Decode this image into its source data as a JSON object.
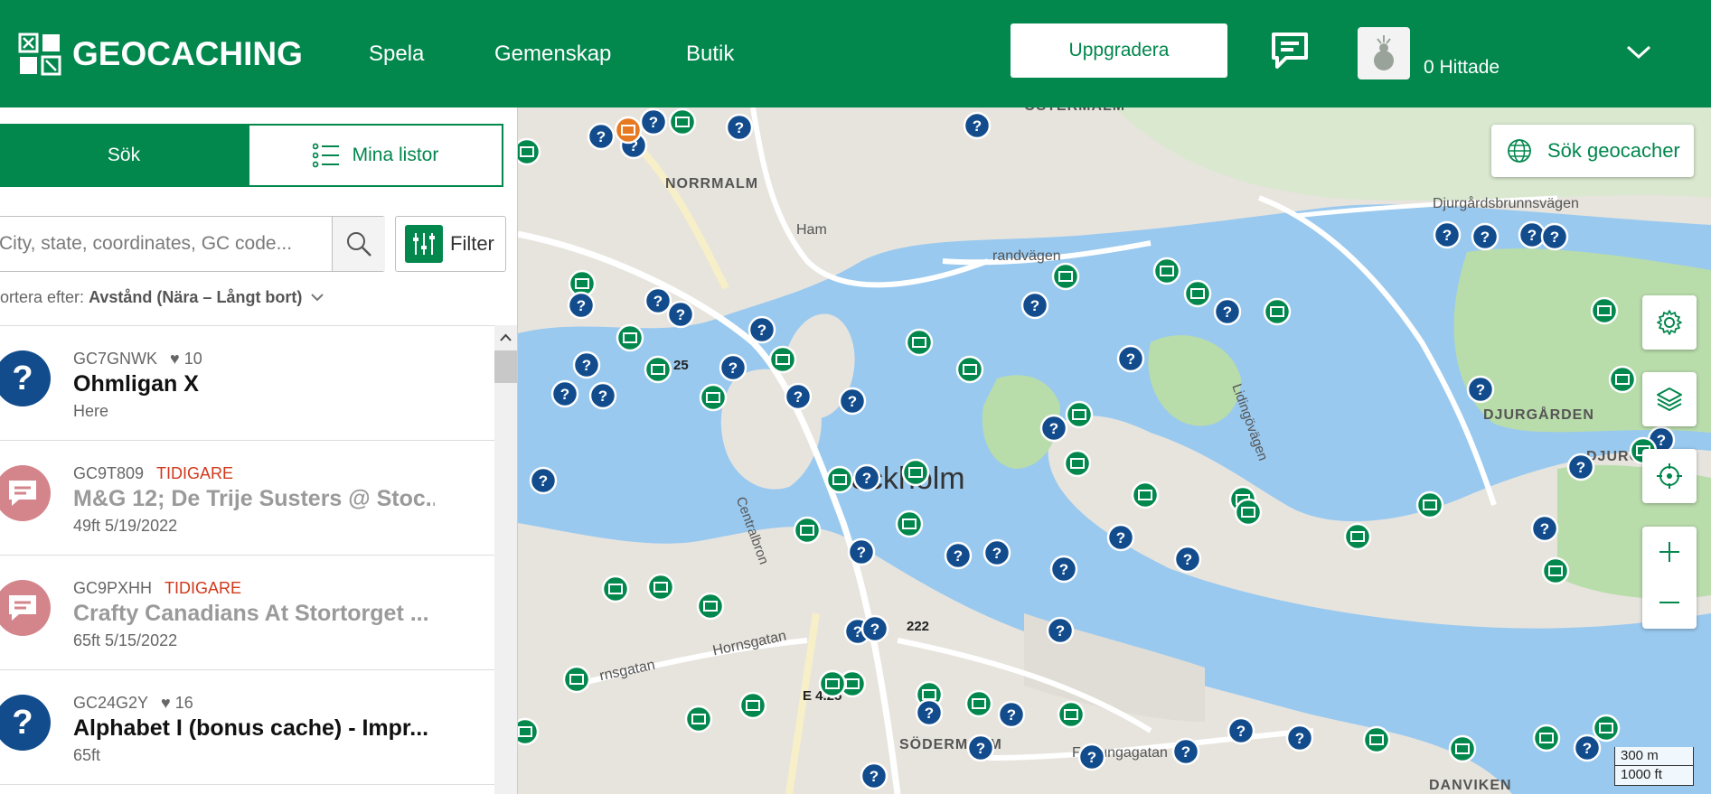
{
  "header": {
    "logo_text": "GEOCACHING",
    "nav": [
      "Spela",
      "Gemenskap",
      "Butik"
    ],
    "upgrade_label": "Uppgradera",
    "found_label": "0 Hittade"
  },
  "sidebar": {
    "tabs": {
      "search": "Sök",
      "lists": "Mina listor"
    },
    "search": {
      "placeholder": "City, state, coordinates, GC code..."
    },
    "filter_label": "Filter",
    "sort": {
      "prefix": "ortera efter:",
      "value": "Avstånd (Nära – Långt bort)"
    },
    "items": [
      {
        "code": "GC7GNWK",
        "tag": "",
        "favorites": "10",
        "name": "Ohmligan X",
        "meta": "Here",
        "type": "mystery",
        "disabled": false
      },
      {
        "code": "GC9T809",
        "tag": "TIDIGARE",
        "favorites": "",
        "name": "M&G 12; De Trije Susters @ Stoc...",
        "meta": "49ft   5/19/2022",
        "type": "event",
        "disabled": true
      },
      {
        "code": "GC9PXHH",
        "tag": "TIDIGARE",
        "favorites": "",
        "name": "Crafty Canadians At Stortorget ...",
        "meta": "65ft   5/15/2022",
        "type": "event",
        "disabled": true
      },
      {
        "code": "GC24G2Y",
        "tag": "",
        "favorites": "16",
        "name": "Alphabet I (bonus cache) - Impr...",
        "meta": "65ft",
        "type": "mystery",
        "disabled": false
      }
    ]
  },
  "map": {
    "search_label": "Sök geocacher",
    "scale_metric": "300 m",
    "scale_imperial": "1000 ft",
    "labels": {
      "stockholm": "ockholm",
      "ostermalm": "ÖSTERMALM",
      "norrmalm": "NORRMALM",
      "djurgarden": "DJURGÅRDEN",
      "djurga": "DJURGA",
      "sodermalm": "SÖDERMALM",
      "danviken": "DANVIKEN",
      "strandvagen": "randvägen",
      "djurgardsbrunnsvagen": "Djurgårdsbrunnsvägen",
      "hornsgatan": "Hornsgatan",
      "hornsgatan2": "rnsgatan",
      "folkungagatan": "Folkungagatan",
      "centralbron": "Centralbron",
      "lidingovagen": "Lidingövägen",
      "e425": "E 4.25",
      "r222": "222",
      "r25": "25",
      "ham": "Ham"
    }
  },
  "colors": {
    "brand": "#02874d",
    "mystery": "#124c8d",
    "event": "#d4858c",
    "traditional": "#02874d",
    "multi": "#e77a21",
    "water": "#99c9ef",
    "park": "#b9dcab"
  }
}
